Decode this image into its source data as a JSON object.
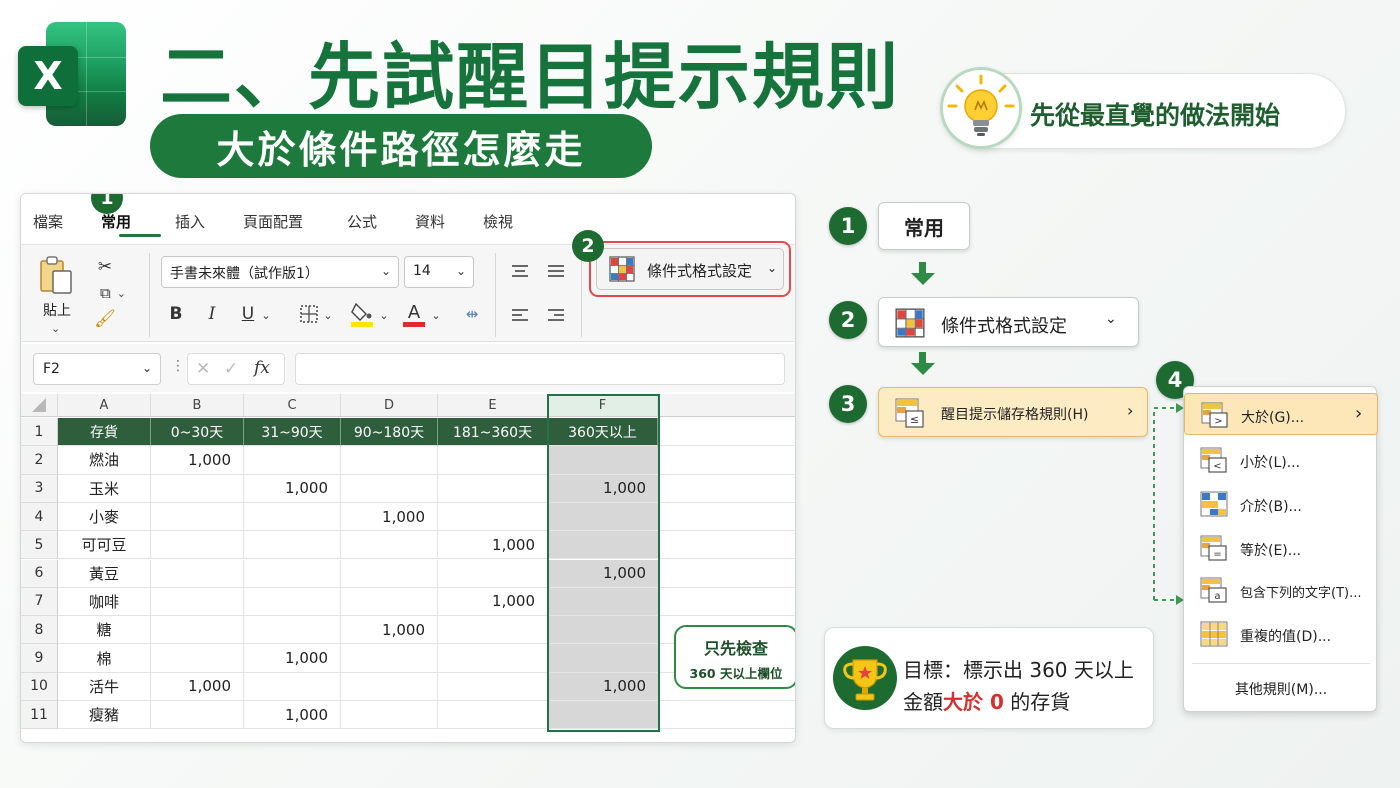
{
  "header": {
    "logo_letter": "X",
    "title": "二、先試醒目提示規則",
    "subtitle": "大於條件路徑怎麼走",
    "tip_text": "先從最直覺的做法開始"
  },
  "excel": {
    "tabs": [
      "檔案",
      "常用",
      "插入",
      "頁面配置",
      "公式",
      "資料",
      "檢視"
    ],
    "active_tab": "常用",
    "paste_label": "貼上",
    "font_name": "手書未來體（試作版1）",
    "font_size": "14",
    "conditional_format_label": "條件式格式設定",
    "bold": "B",
    "italic": "I",
    "underline": "U",
    "name_box": "F2",
    "fx_label": "fx",
    "columns": [
      "A",
      "B",
      "C",
      "D",
      "E",
      "F"
    ],
    "header_row": [
      "存貨",
      "0~30天",
      "31~90天",
      "90~180天",
      "181~360天",
      "360天以上"
    ],
    "rows": [
      {
        "num": "2",
        "item": "燃油",
        "b": "1,000",
        "c": "",
        "d": "",
        "e": "",
        "f": ""
      },
      {
        "num": "3",
        "item": "玉米",
        "b": "",
        "c": "1,000",
        "d": "",
        "e": "",
        "f": "1,000"
      },
      {
        "num": "4",
        "item": "小麥",
        "b": "",
        "c": "",
        "d": "1,000",
        "e": "",
        "f": ""
      },
      {
        "num": "5",
        "item": "可可豆",
        "b": "",
        "c": "",
        "d": "",
        "e": "1,000",
        "f": ""
      },
      {
        "num": "6",
        "item": "黃豆",
        "b": "",
        "c": "",
        "d": "",
        "e": "",
        "f": "1,000"
      },
      {
        "num": "7",
        "item": "咖啡",
        "b": "",
        "c": "",
        "d": "",
        "e": "1,000",
        "f": ""
      },
      {
        "num": "8",
        "item": "糖",
        "b": "",
        "c": "",
        "d": "1,000",
        "e": "",
        "f": ""
      },
      {
        "num": "9",
        "item": "棉",
        "b": "",
        "c": "1,000",
        "d": "",
        "e": "",
        "f": ""
      },
      {
        "num": "10",
        "item": "活牛",
        "b": "1,000",
        "c": "",
        "d": "",
        "e": "",
        "f": "1,000"
      },
      {
        "num": "11",
        "item": "瘦豬",
        "b": "",
        "c": "1,000",
        "d": "",
        "e": "",
        "f": ""
      }
    ],
    "callout_line1": "只先檢查",
    "callout_line2": "360 天以上欄位"
  },
  "flow": {
    "step_numbers": [
      "1",
      "2",
      "3",
      "4"
    ],
    "step1_label": "常用",
    "step2_label": "條件式格式設定",
    "step3_label": "醒目提示儲存格規則(H)",
    "submenu": [
      "大於(G)...",
      "小於(L)...",
      "介於(B)...",
      "等於(E)...",
      "包含下列的文字(T)...",
      "重複的值(D)..."
    ],
    "submenu_more": "其他規則(M)..."
  },
  "goal": {
    "line1": "目標：標示出 360 天以上",
    "line2_pre": "金額",
    "line2_emph": "大於 0",
    "line2_post": " 的存貨"
  },
  "colors": {
    "brand_green": "#1e7a3c",
    "header_row_bg": "#2f5e3d",
    "highlight_red": "#e04b4b",
    "menu_highlight": "#fde6b8"
  }
}
